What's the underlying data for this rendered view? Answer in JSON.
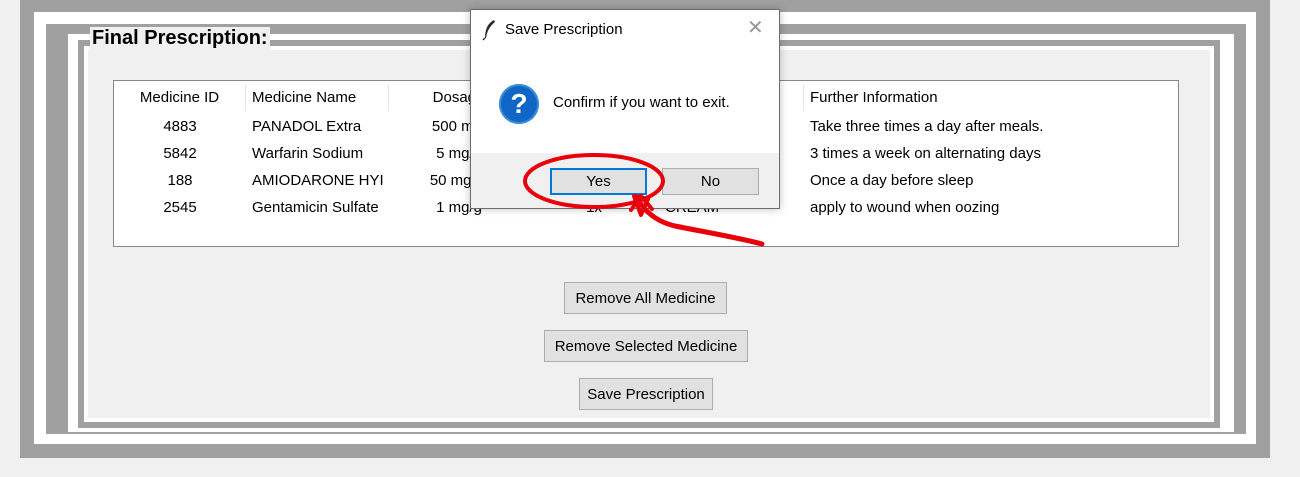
{
  "frame": {
    "title": "Final Prescription:"
  },
  "table": {
    "columns": [
      "Medicine ID",
      "Medicine Name",
      "Dosage",
      "",
      "",
      "Further Information"
    ],
    "rows": [
      [
        "4883",
        "PANADOL Extra",
        "500 mg/",
        "",
        "",
        "Take  three times a day after meals."
      ],
      [
        "5842",
        "Warfarin Sodium",
        "5 mg/1",
        "",
        "",
        "3 times a week on alternating days"
      ],
      [
        "188",
        "AMIODARONE HYI",
        "50 mg/m",
        "",
        "",
        "Once a day before sleep"
      ],
      [
        "2545",
        "Gentamicin Sulfate",
        "1 mg/g",
        "1x",
        "CREAM",
        "apply to wound when oozing"
      ]
    ]
  },
  "buttons": {
    "remove_all": "Remove All Medicine",
    "remove_selected": "Remove Selected Medicine",
    "save": "Save Prescription"
  },
  "dialog": {
    "title": "Save Prescription",
    "message": "Confirm if you want to exit.",
    "icon": "question-icon",
    "yes": "Yes",
    "no": "No",
    "close_glyph": "✕"
  },
  "colors": {
    "annotation": "#e8000b",
    "question_icon": "#0f66c4",
    "focus_border": "#0078d7"
  }
}
